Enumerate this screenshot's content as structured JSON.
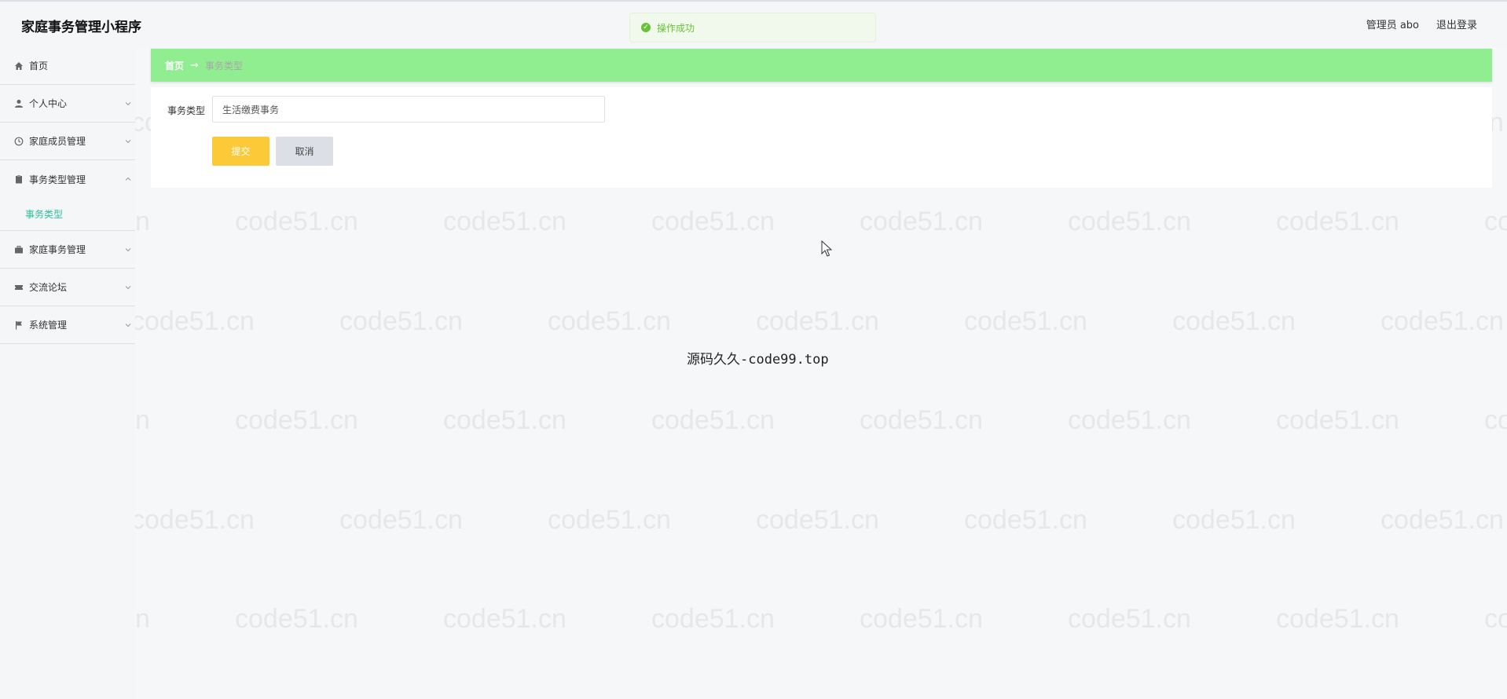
{
  "header": {
    "app_title": "家庭事务管理小程序",
    "admin_label": "管理员 abo",
    "logout_label": "退出登录"
  },
  "toast": {
    "message": "操作成功"
  },
  "sidebar": {
    "items": [
      {
        "label": "首页",
        "icon": "home-icon"
      },
      {
        "label": "个人中心",
        "icon": "user-icon"
      },
      {
        "label": "家庭成员管理",
        "icon": "clock-icon"
      },
      {
        "label": "事务类型管理",
        "icon": "clipboard-icon",
        "expanded": true,
        "children": [
          {
            "label": "事务类型"
          }
        ]
      },
      {
        "label": "家庭事务管理",
        "icon": "briefcase-icon"
      },
      {
        "label": "交流论坛",
        "icon": "ticket-icon"
      },
      {
        "label": "系统管理",
        "icon": "flag-icon"
      }
    ]
  },
  "breadcrumb": {
    "home": "首页",
    "arrow": "→",
    "current": "事务类型"
  },
  "form": {
    "field_label": "事务类型",
    "field_value": "生活缴费事务",
    "submit_label": "提交",
    "cancel_label": "取消"
  },
  "footer": {
    "text": "源码久久-code99.top"
  },
  "watermark": {
    "text": "code51.cn"
  },
  "colors": {
    "breadcrumb_bg": "#90ee90",
    "submit_bg": "#fcca39",
    "active_submenu": "#2bbf9e",
    "toast_green": "#67c23a"
  }
}
